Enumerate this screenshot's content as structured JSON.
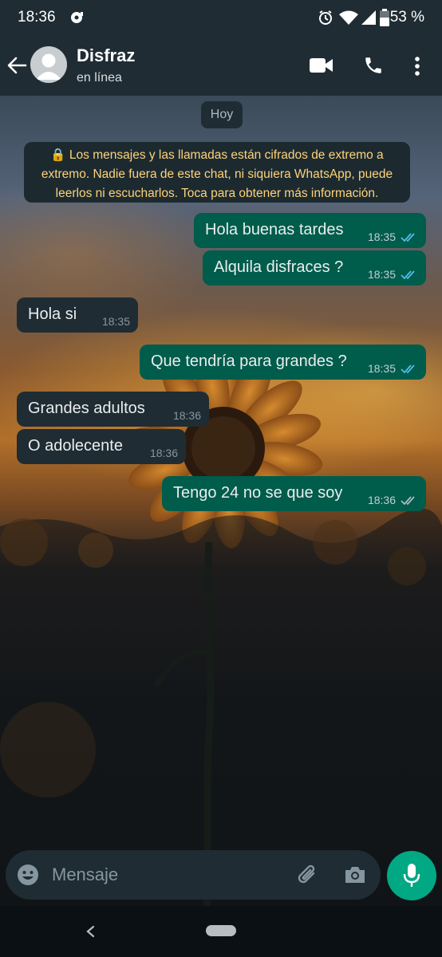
{
  "status_bar": {
    "time": "18:36",
    "battery": "53 %"
  },
  "header": {
    "contact_name": "Disfraz",
    "contact_status": "en línea"
  },
  "chat": {
    "date_chip": "Hoy",
    "encryption_notice": "🔒 Los mensajes y las llamadas están cifrados de extremo a extremo. Nadie fuera de este chat, ni siquiera WhatsApp, puede leerlos ni escucharlos. Toca para obtener más información.",
    "messages": [
      {
        "direction": "out",
        "text": "Hola buenas tardes",
        "time": "18:35",
        "status": "read"
      },
      {
        "direction": "out",
        "text": "Alquila disfraces ?",
        "time": "18:35",
        "status": "read"
      },
      {
        "direction": "in",
        "text": "Hola si",
        "time": "18:35"
      },
      {
        "direction": "out",
        "text": "Que tendría para grandes ?",
        "time": "18:35",
        "status": "read"
      },
      {
        "direction": "in",
        "text": "Grandes adultos",
        "time": "18:36"
      },
      {
        "direction": "in",
        "text": "O adolecente",
        "time": "18:36"
      },
      {
        "direction": "out",
        "text": "Tengo 24 no se que soy",
        "time": "18:36",
        "status": "delivered"
      }
    ]
  },
  "composer": {
    "placeholder": "Mensaje"
  },
  "colors": {
    "app_bar": "#1f2c34",
    "outgoing_bubble": "#005c4b",
    "incoming_bubble": "#1f2c33",
    "accent": "#00a884",
    "read_tick": "#53bdeb",
    "notice_text": "#ffd279"
  },
  "icons": [
    "back-arrow-icon",
    "avatar-icon",
    "video-call-icon",
    "phone-icon",
    "more-options-icon",
    "emoji-icon",
    "attach-icon",
    "camera-icon",
    "mic-icon",
    "alarm-icon",
    "wifi-icon",
    "signal-icon",
    "battery-icon",
    "nav-back-icon"
  ]
}
